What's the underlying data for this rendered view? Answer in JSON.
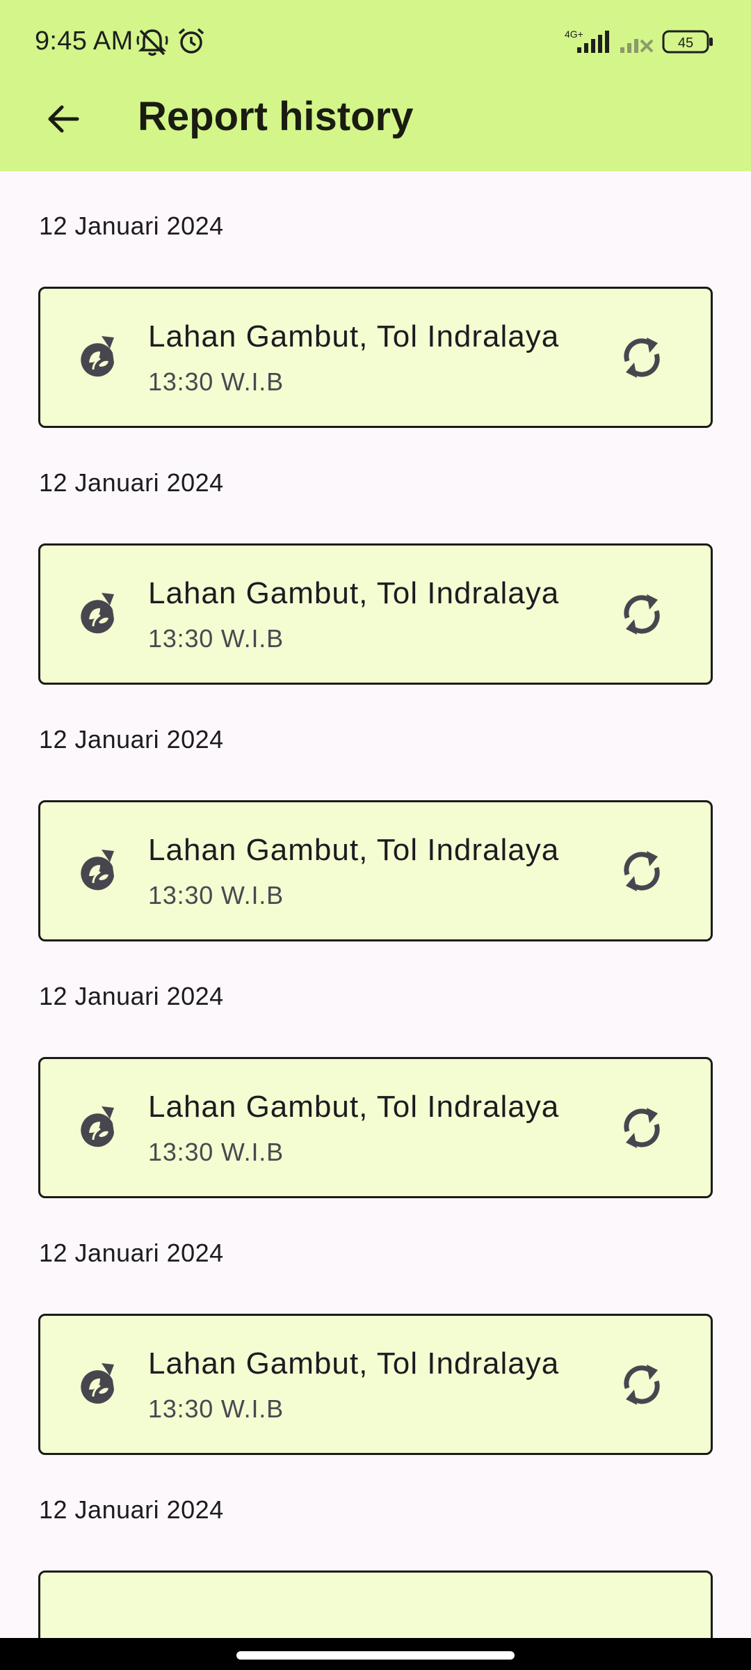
{
  "status_bar": {
    "time": "9:45 AM",
    "network_type": "4G+",
    "battery_level": "45",
    "icons": [
      "bell-off-icon",
      "alarm-icon",
      "signal-icon",
      "signal-off-icon",
      "battery-icon"
    ]
  },
  "toolbar": {
    "title": "Report history",
    "back_icon": "arrow-back-icon"
  },
  "colors": {
    "appbar_bg": "#d3f58a",
    "card_bg": "#f3fdd1",
    "page_bg": "#fdf8fc",
    "icon_color": "#47464f"
  },
  "reports": [
    {
      "date": "12 Januari 2024",
      "location": "Lahan Gambut, Tol Indralaya",
      "time": "13:30 W.I.B",
      "lead_icon": "plant-refresh-icon",
      "action_icon": "sync-icon"
    },
    {
      "date": "12 Januari 2024",
      "location": "Lahan Gambut, Tol Indralaya",
      "time": "13:30 W.I.B",
      "lead_icon": "plant-refresh-icon",
      "action_icon": "sync-icon"
    },
    {
      "date": "12 Januari 2024",
      "location": "Lahan Gambut, Tol Indralaya",
      "time": "13:30 W.I.B",
      "lead_icon": "plant-refresh-icon",
      "action_icon": "sync-icon"
    },
    {
      "date": "12 Januari 2024",
      "location": "Lahan Gambut, Tol Indralaya",
      "time": "13:30 W.I.B",
      "lead_icon": "plant-refresh-icon",
      "action_icon": "sync-icon"
    },
    {
      "date": "12 Januari 2024",
      "location": "Lahan Gambut, Tol Indralaya",
      "time": "13:30 W.I.B",
      "lead_icon": "plant-refresh-icon",
      "action_icon": "sync-icon"
    },
    {
      "date": "12 Januari 2024",
      "location": "",
      "time": "",
      "lead_icon": "",
      "action_icon": ""
    }
  ]
}
